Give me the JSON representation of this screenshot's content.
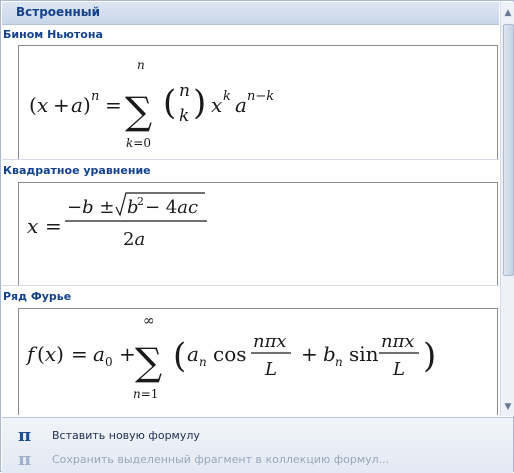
{
  "panel": {
    "header": "Встроенный"
  },
  "sections": [
    {
      "title": "Бином Ньютона",
      "formula": "(x + a)^n = Σ_{k=0}^{n} C(n,k) x^k a^{n−k}"
    },
    {
      "title": "Квадратное уравнение",
      "formula": "x = (−b ± √(b² − 4ac)) / 2a"
    },
    {
      "title": "Ряд Фурье",
      "formula": "f(x) = a₀ + Σ_{n=1}^{∞} (aₙ cos(nπx/L) + bₙ sin(nπx/L))"
    }
  ],
  "footer": {
    "insert_label": "Вставить новую формулу",
    "save_label": "Сохранить выделенный фрагмент в коллекцию формул...",
    "insert_icon": "pi-icon",
    "save_icon": "save-formula-icon"
  },
  "colors": {
    "header_text": "#15428b",
    "accent": "#1f4e99"
  }
}
